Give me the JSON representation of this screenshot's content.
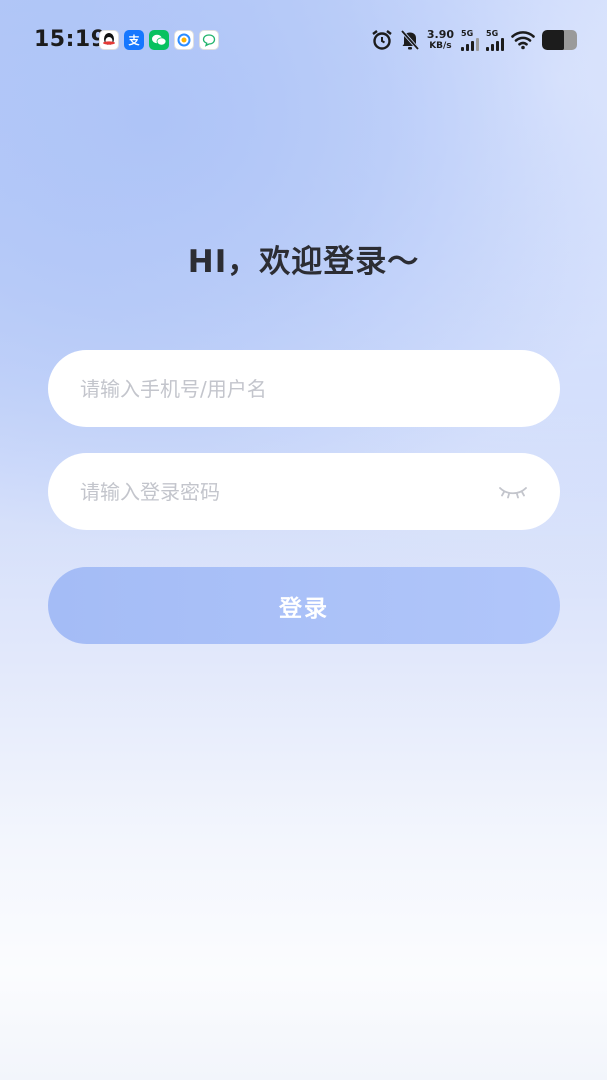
{
  "status_bar": {
    "time": "15:19",
    "app_icons": [
      "qq-icon",
      "alipay-icon",
      "wechat-icon",
      "qq-browser-icon",
      "message-icon"
    ],
    "alipay_glyph": "支",
    "net_speed_value": "3.90",
    "net_speed_unit": "KB/s",
    "sim1_label": "5G",
    "sim2_label": "5G"
  },
  "login": {
    "title": "HI，欢迎登录～",
    "username_placeholder": "请输入手机号/用户名",
    "password_placeholder": "请输入登录密码",
    "submit_label": "登录"
  },
  "colors": {
    "title": "#2c2d33",
    "button": "#a4bcf6",
    "placeholder": "#c3c5cc"
  }
}
